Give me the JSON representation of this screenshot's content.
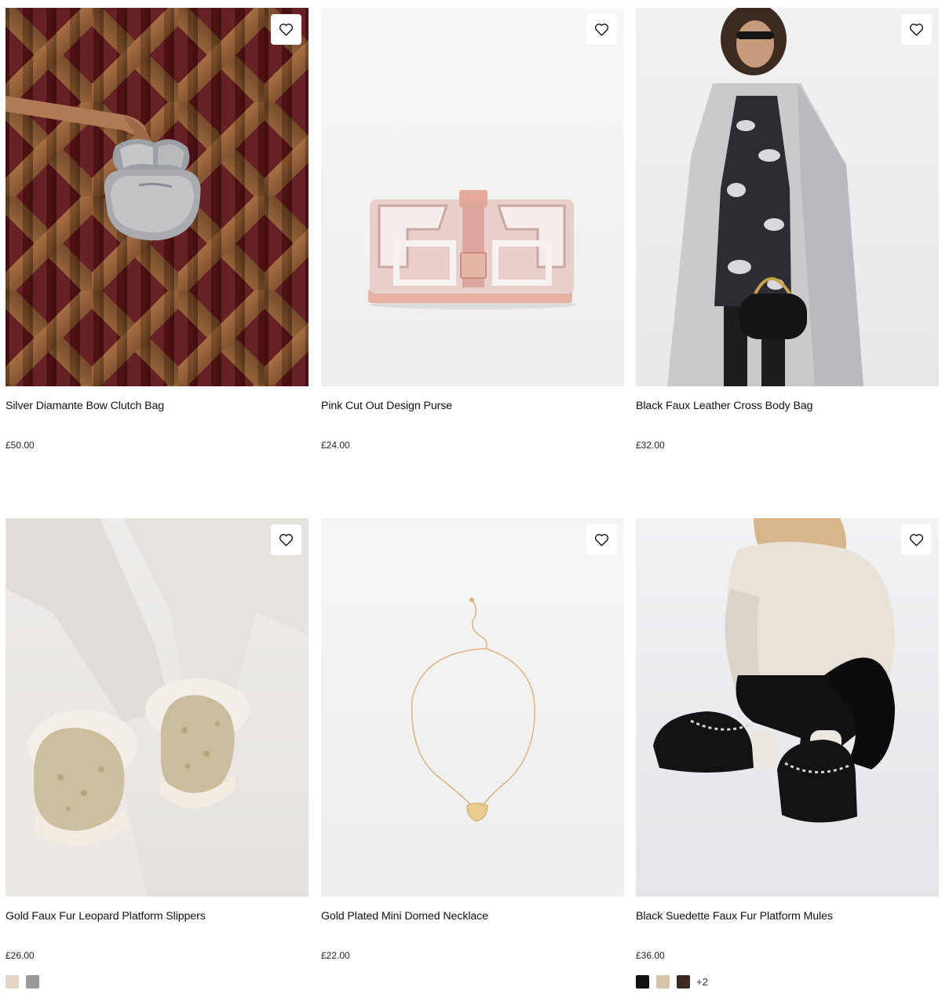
{
  "products": [
    {
      "title": "Silver Diamante Bow Clutch Bag",
      "price": "£50.00",
      "image_icon": "silver-clutch-bag-photo",
      "swatches": [],
      "more_colours": ""
    },
    {
      "title": "Pink Cut Out Design Purse",
      "price": "£24.00",
      "image_icon": "pink-purse-photo",
      "swatches": [],
      "more_colours": ""
    },
    {
      "title": "Black Faux Leather Cross Body Bag",
      "price": "£32.00",
      "image_icon": "black-cross-body-bag-photo",
      "swatches": [],
      "more_colours": ""
    },
    {
      "title": "Gold Faux Fur Leopard Platform Slippers",
      "price": "£26.00",
      "image_icon": "gold-slippers-photo",
      "swatches": [
        "#e3d5c6",
        "#9b9998"
      ],
      "more_colours": ""
    },
    {
      "title": "Gold Plated Mini Domed Necklace",
      "price": "£22.00",
      "image_icon": "gold-necklace-photo",
      "swatches": [],
      "more_colours": ""
    },
    {
      "title": "Black Suedette Faux Fur Platform Mules",
      "price": "£36.00",
      "image_icon": "black-mules-photo",
      "swatches": [
        "#111111",
        "#d7c2aa",
        "#3b2a24"
      ],
      "more_colours": "+2"
    }
  ],
  "wishlist_icon": "heart-icon"
}
